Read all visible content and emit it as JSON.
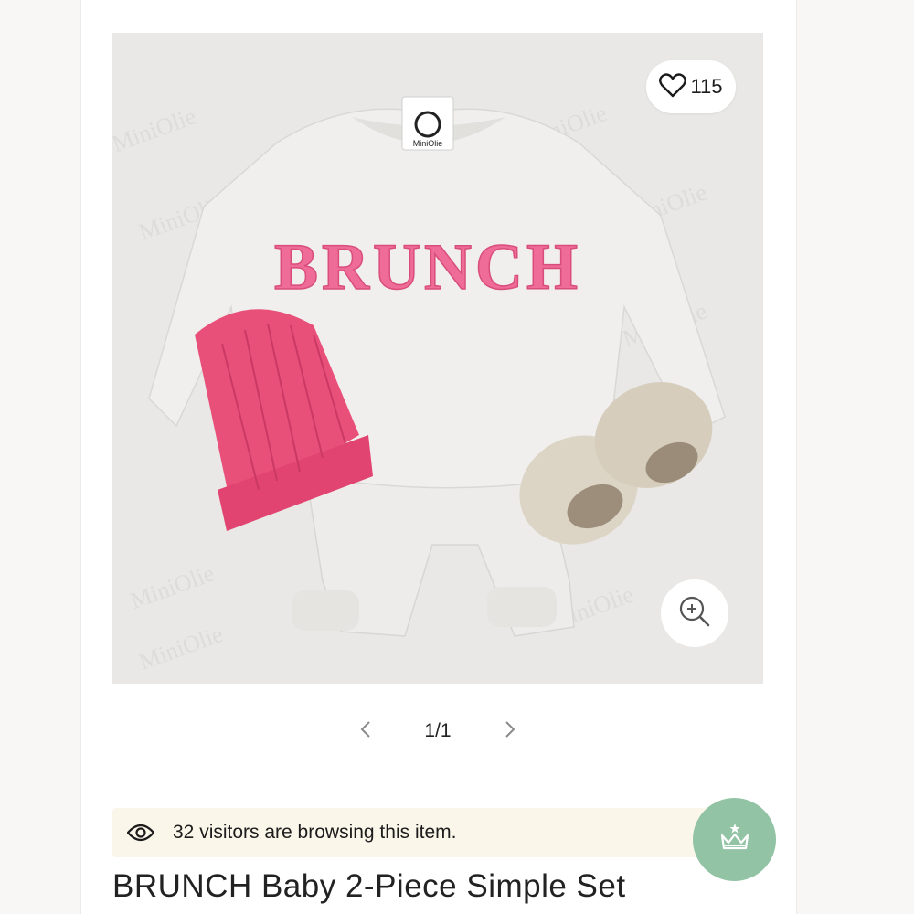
{
  "product": {
    "title": "BRUNCH Baby 2-Piece Simple Set",
    "wishlist_count": "115",
    "image_print_text": "BRUNCH",
    "watermark_text": "MiniOlie",
    "tag_text": "MiniOlie"
  },
  "gallery": {
    "page_indicator": "1/1"
  },
  "visitors": {
    "text": "32 visitors are browsing this item."
  },
  "colors": {
    "accent_green": "#92c3a4",
    "banner_bg": "#fbf6ea",
    "beanie_pink": "#e8507a"
  },
  "icons": {
    "wishlist": "heart-icon",
    "zoom": "zoom-in-icon",
    "prev": "chevron-left-icon",
    "next": "chevron-right-icon",
    "visitors": "eye-icon",
    "vip": "crown-icon"
  }
}
